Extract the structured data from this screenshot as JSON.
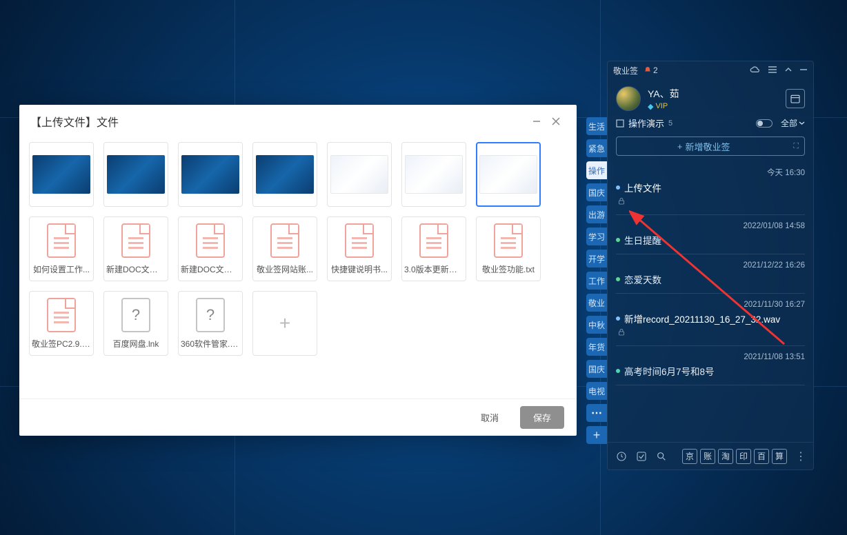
{
  "upload": {
    "title": "【上传文件】文件",
    "cancel": "取消",
    "save": "保存",
    "image_tiles": [
      {
        "style": "dark"
      },
      {
        "style": "dark"
      },
      {
        "style": "dark"
      },
      {
        "style": "dark"
      },
      {
        "style": "light"
      },
      {
        "style": "light"
      },
      {
        "style": "light",
        "selected": true
      }
    ],
    "file_tiles": [
      {
        "name": "如何设置工作...",
        "type": "doc"
      },
      {
        "name": "新建DOC文档(...",
        "type": "doc"
      },
      {
        "name": "新建DOC文档(...",
        "type": "doc"
      },
      {
        "name": "敬业签网站账...",
        "type": "doc"
      },
      {
        "name": "快捷键说明书...",
        "type": "doc"
      },
      {
        "name": "3.0版本更新会...",
        "type": "doc"
      },
      {
        "name": "敬业签功能.txt",
        "type": "doc"
      },
      {
        "name": "敬业签PC2.9.0...",
        "type": "doc"
      },
      {
        "name": "百度网盘.lnk",
        "type": "unknown"
      },
      {
        "name": "360软件管家.lnk",
        "type": "unknown"
      }
    ]
  },
  "sidebar": {
    "app_name": "敬业签",
    "bell_count": "2",
    "user_name": "YA、茹",
    "vip_label": "VIP",
    "section_title": "操作演示",
    "section_count": "5",
    "filter_label": "全部",
    "add_label": "新增敬业签",
    "tabs": [
      "生活",
      "紧急",
      "操作演示",
      "国庆",
      "出游",
      "学习",
      "开学",
      "工作",
      "敬业",
      "中秋",
      "年货",
      "国庆",
      "电视"
    ],
    "bottom_sq": [
      "京",
      "账",
      "淘",
      "印",
      "百",
      "算"
    ],
    "notes": [
      {
        "date": "今天 16:30",
        "title": "上传文件",
        "dot": "blue",
        "lock": true,
        "selected": true
      },
      {
        "date": "2022/01/08 14:58",
        "title": "生日提醒",
        "dot": "green"
      },
      {
        "date": "2021/12/22 16:26",
        "title": "恋爱天数",
        "dot": "green"
      },
      {
        "date": "2021/11/30 16:27",
        "title": "新增record_20211130_16_27_32.wav",
        "dot": "blue",
        "lock": true,
        "selected": true
      },
      {
        "date": "2021/11/08 13:51",
        "title": "高考时间6月7号和8号",
        "dot": "green2"
      }
    ]
  }
}
